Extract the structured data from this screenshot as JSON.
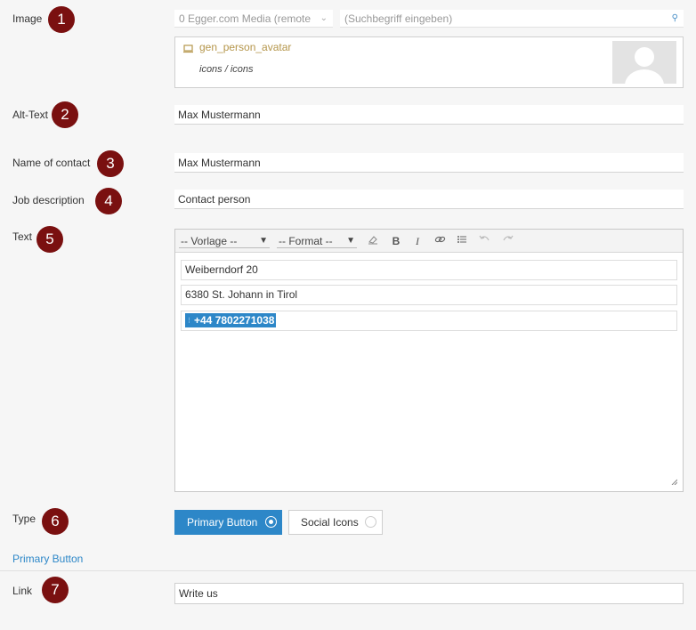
{
  "colors": {
    "badge": "#7a1010",
    "primary": "#2d87c8",
    "link": "#2d87c8",
    "media_name": "#b5964b",
    "highlight": "#2d87c8"
  },
  "image": {
    "label": "Image",
    "badge": "1",
    "source_select": "0 Egger.com Media (remote",
    "search_placeholder": "(Suchbegriff eingeben)",
    "search_icon": "search-icon",
    "media_name": "gen_person_avatar",
    "media_path": "icons / icons",
    "media_icon": "monitor-icon",
    "thumbnail": "person-avatar-placeholder"
  },
  "alt_text": {
    "label": "Alt-Text",
    "badge": "2",
    "value": "Max Mustermann"
  },
  "name_of_contact": {
    "label": "Name of contact",
    "badge": "3",
    "value": "Max Mustermann"
  },
  "job_description": {
    "label": "Job description",
    "badge": "4",
    "value": "Contact person"
  },
  "text": {
    "label": "Text",
    "badge": "5",
    "toolbar": {
      "vorlage": "-- Vorlage --",
      "format": "-- Format --",
      "icons": [
        "eraser-icon",
        "bold-icon",
        "italic-icon",
        "link-icon",
        "list-icon",
        "undo-icon",
        "redo-icon"
      ],
      "bold": "B",
      "italic": "I"
    },
    "paragraphs": [
      "Weiberndorf 20",
      "6380 St. Johann in Tirol"
    ],
    "phone": "+44 7802271038"
  },
  "type": {
    "label": "Type",
    "badge": "6",
    "options": [
      "Primary Button",
      "Social Icons"
    ],
    "selected": "Primary Button"
  },
  "section_link": "Primary Button",
  "link": {
    "label": "Link",
    "badge": "7",
    "value": "Write us"
  }
}
